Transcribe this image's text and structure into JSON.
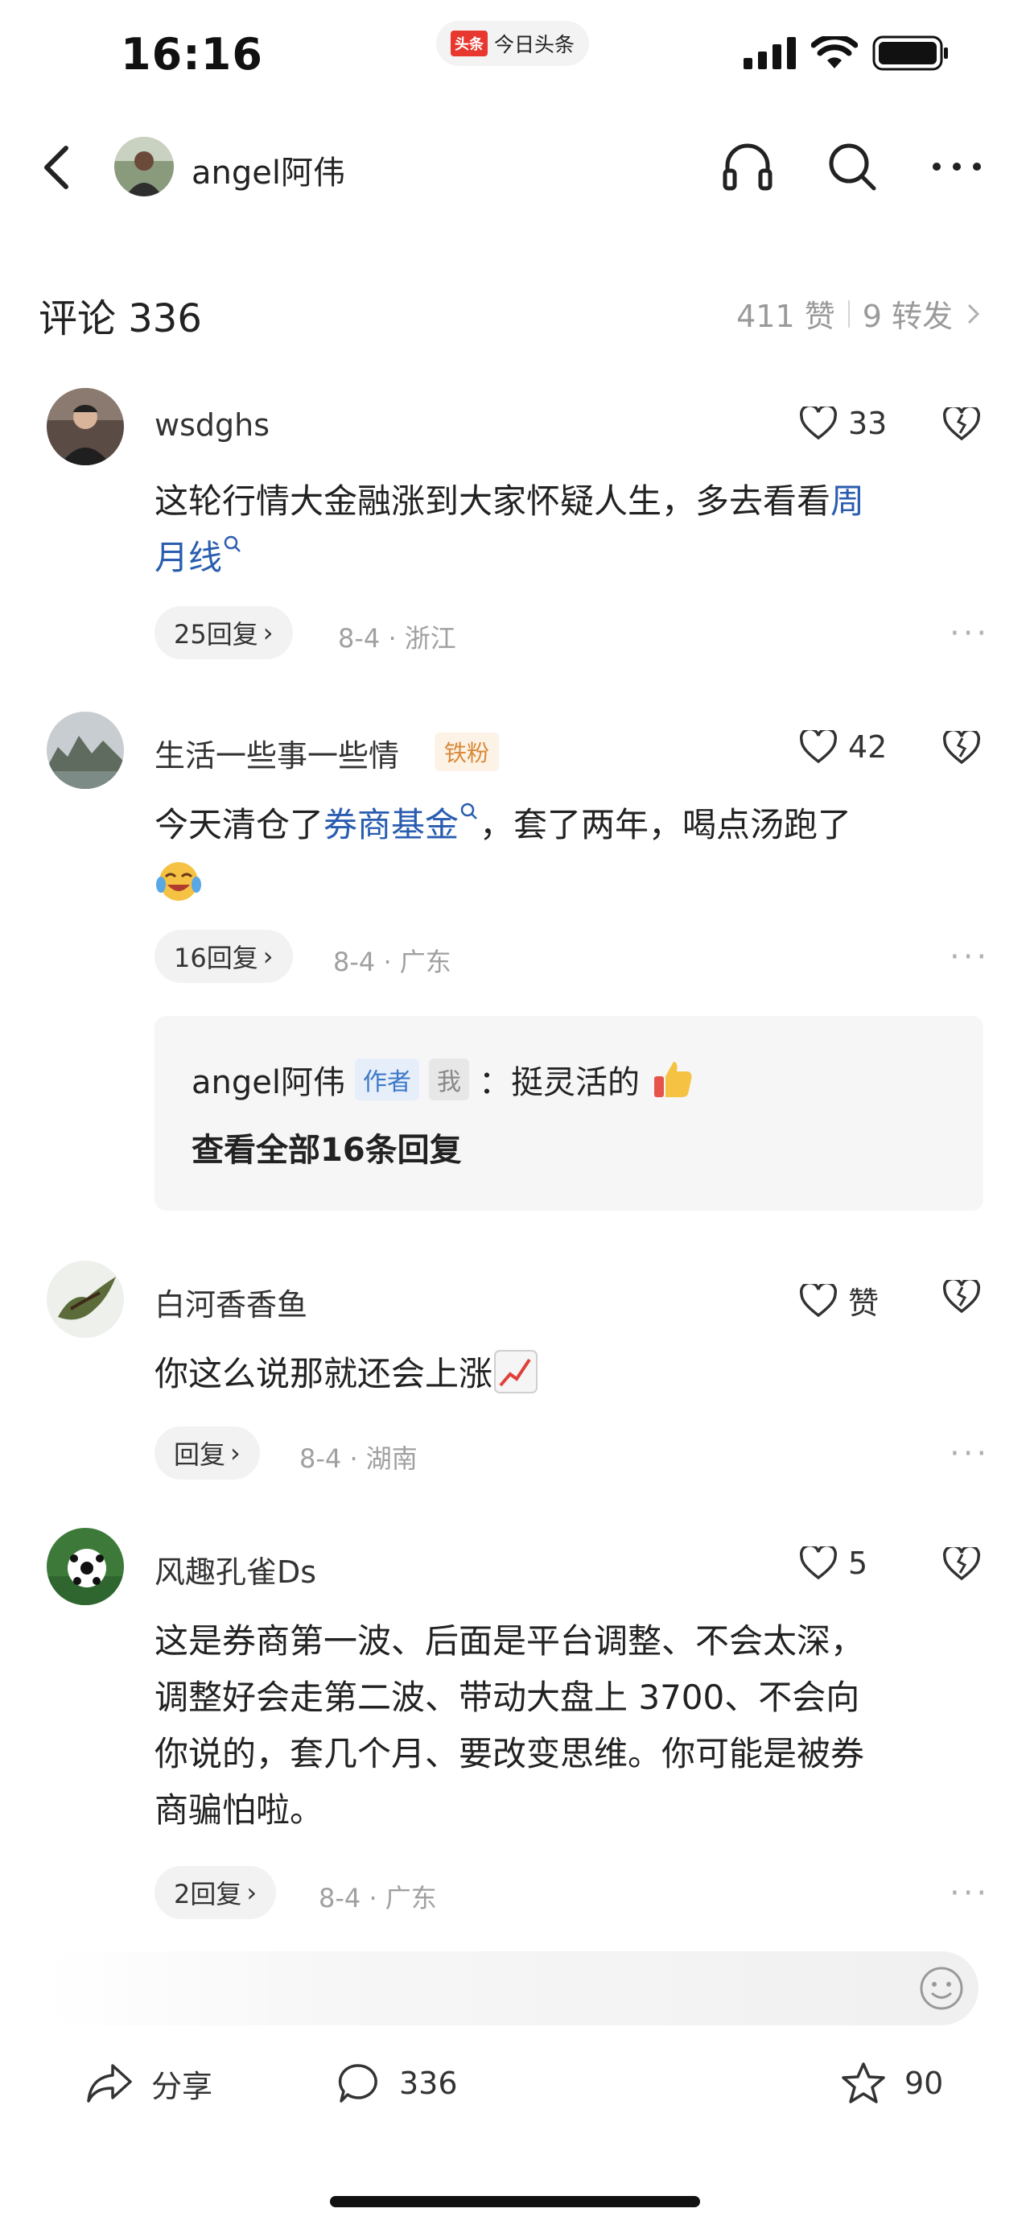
{
  "status_bar": {
    "time": "16:16",
    "app_logo": "头条",
    "app_name": "今日头条"
  },
  "nav": {
    "author": "angel阿伟",
    "icons": [
      "back-icon",
      "headphones-icon",
      "search-icon",
      "more-icon"
    ]
  },
  "header": {
    "title": "评论 336",
    "likes": "411 赞",
    "shares": "9 转发"
  },
  "comments": [
    {
      "user": "wsdghs",
      "likes": "33",
      "text_a": "这轮行情大金融涨到大家怀疑人生，多去看看",
      "link_a": "周",
      "link_b": "月线",
      "reply": "25回复",
      "meta": "8-4 · 浙江"
    },
    {
      "user": "生活一些事一些情",
      "badge": "铁粉",
      "likes": "42",
      "text_a": "今天清仓了",
      "link": "券商基金",
      "text_b": "，套了两年，喝点汤跑了",
      "reply": "16回复",
      "meta": "8-4 · 广东",
      "sub_reply": {
        "author": "angel阿伟",
        "author_badge": "作者",
        "me_badge": "我",
        "text": "：挺灵活的",
        "view_all": "查看全部16条回复"
      }
    },
    {
      "user": "白河香香鱼",
      "likes": "赞",
      "text": "你这么说那就还会上涨",
      "reply": "回复",
      "meta": "8-4 · 湖南"
    },
    {
      "user": "风趣孔雀Ds",
      "likes": "5",
      "lines": [
        "这是券商第一波、后面是平台调整、不会太深，",
        "调整好会走第二波、带动大盘上 3700、不会向",
        "你说的，套几个月、要改变思维。你可能是被券",
        "商骗怕啦。"
      ],
      "reply": "2回复",
      "meta": "8-4 · 广东"
    }
  ],
  "bottom": {
    "share": "分享",
    "comments": "336",
    "favorites": "90"
  },
  "colors": {
    "link": "#2a5db0",
    "fan_badge": "#d98a3a",
    "author_badge": "#3c78c8",
    "meta": "#a0a0a0"
  }
}
